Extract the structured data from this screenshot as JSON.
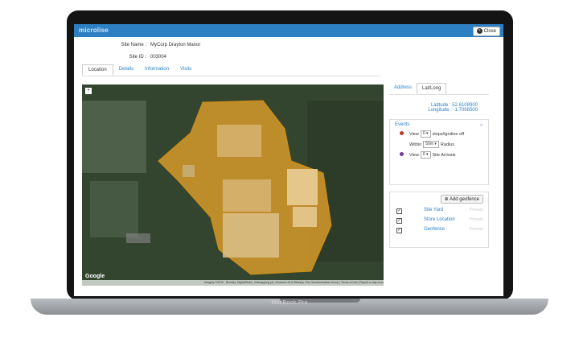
{
  "device": {
    "model": "MacBook Pro"
  },
  "app": {
    "brand": "microlise",
    "close_label": "Close"
  },
  "site": {
    "name_label": "Site Name :",
    "name_value": "MyCorp Drayton Manor",
    "id_label": "Site ID :",
    "id_value": "003004"
  },
  "tabs": [
    "Location",
    "Details",
    "Information",
    "Visits"
  ],
  "map": {
    "zoom_label": "+",
    "google_label": "Google",
    "footer": "Imagery ©2019 , Bluesky, DigitalGlobe, Getmapping plc, Infoterra Ltd & Bluesky, The GeoInformation Group | Terms of Use | Report a map error"
  },
  "side_tabs": [
    "Address",
    "Lat/Long"
  ],
  "coords": {
    "lat_label": "Latitude :",
    "lat_value": "52.6108900",
    "lng_label": "Longitude :",
    "lng_value": "-1.7098500"
  },
  "events": {
    "title": "Events",
    "view_label": "View",
    "stops_value": "0",
    "stops_text": "stops/ignition off",
    "within_label": "Within",
    "radius_value": "50m",
    "radius_text": "Radius",
    "arrivals_value": "0",
    "arrivals_text": "Site Arrivals",
    "colors": {
      "stops": "#c0392b",
      "arrivals": "#7d3c98"
    }
  },
  "geofence": {
    "add_label": "Add geofence",
    "items": [
      {
        "name": "Site Yard",
        "checked": true,
        "right": "Primary"
      },
      {
        "name": "Store Location",
        "checked": true,
        "right": "Primary"
      },
      {
        "name": "Geofence",
        "checked": true,
        "right": "Primary"
      }
    ]
  },
  "colors": {
    "topbar": "#2d7fc4",
    "geofence_fill": "#e5a22a"
  }
}
